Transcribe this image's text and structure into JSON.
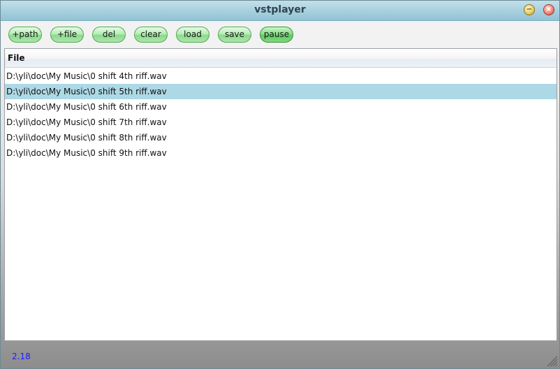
{
  "window": {
    "title": "vstplayer",
    "min_glyph": "−",
    "close_glyph": "×"
  },
  "toolbar": {
    "buttons": [
      {
        "label": "+path"
      },
      {
        "label": "+file"
      },
      {
        "label": "del"
      },
      {
        "label": "clear"
      },
      {
        "label": "load"
      },
      {
        "label": "save"
      },
      {
        "label": "pause"
      }
    ]
  },
  "list": {
    "header": "File",
    "selected_index": 1,
    "rows": [
      "D:\\yli\\doc\\My Music\\0 shift 4th riff.wav",
      "D:\\yli\\doc\\My Music\\0 shift 5th riff.wav",
      "D:\\yli\\doc\\My Music\\0 shift 6th riff.wav",
      "D:\\yli\\doc\\My Music\\0 shift 7th riff.wav",
      "D:\\yli\\doc\\My Music\\0 shift 8th riff.wav",
      "D:\\yli\\doc\\My Music\\0 shift 9th riff.wav"
    ]
  },
  "status": {
    "version": "2.18"
  },
  "colors": {
    "titlebar": "#a9d1df",
    "button_green": "#b5efb5",
    "selection": "#add8e6",
    "version_text": "#1a1aff"
  },
  "icons": {
    "minimize": "minimize-icon",
    "close": "close-icon",
    "resize": "resize-grip-icon"
  }
}
